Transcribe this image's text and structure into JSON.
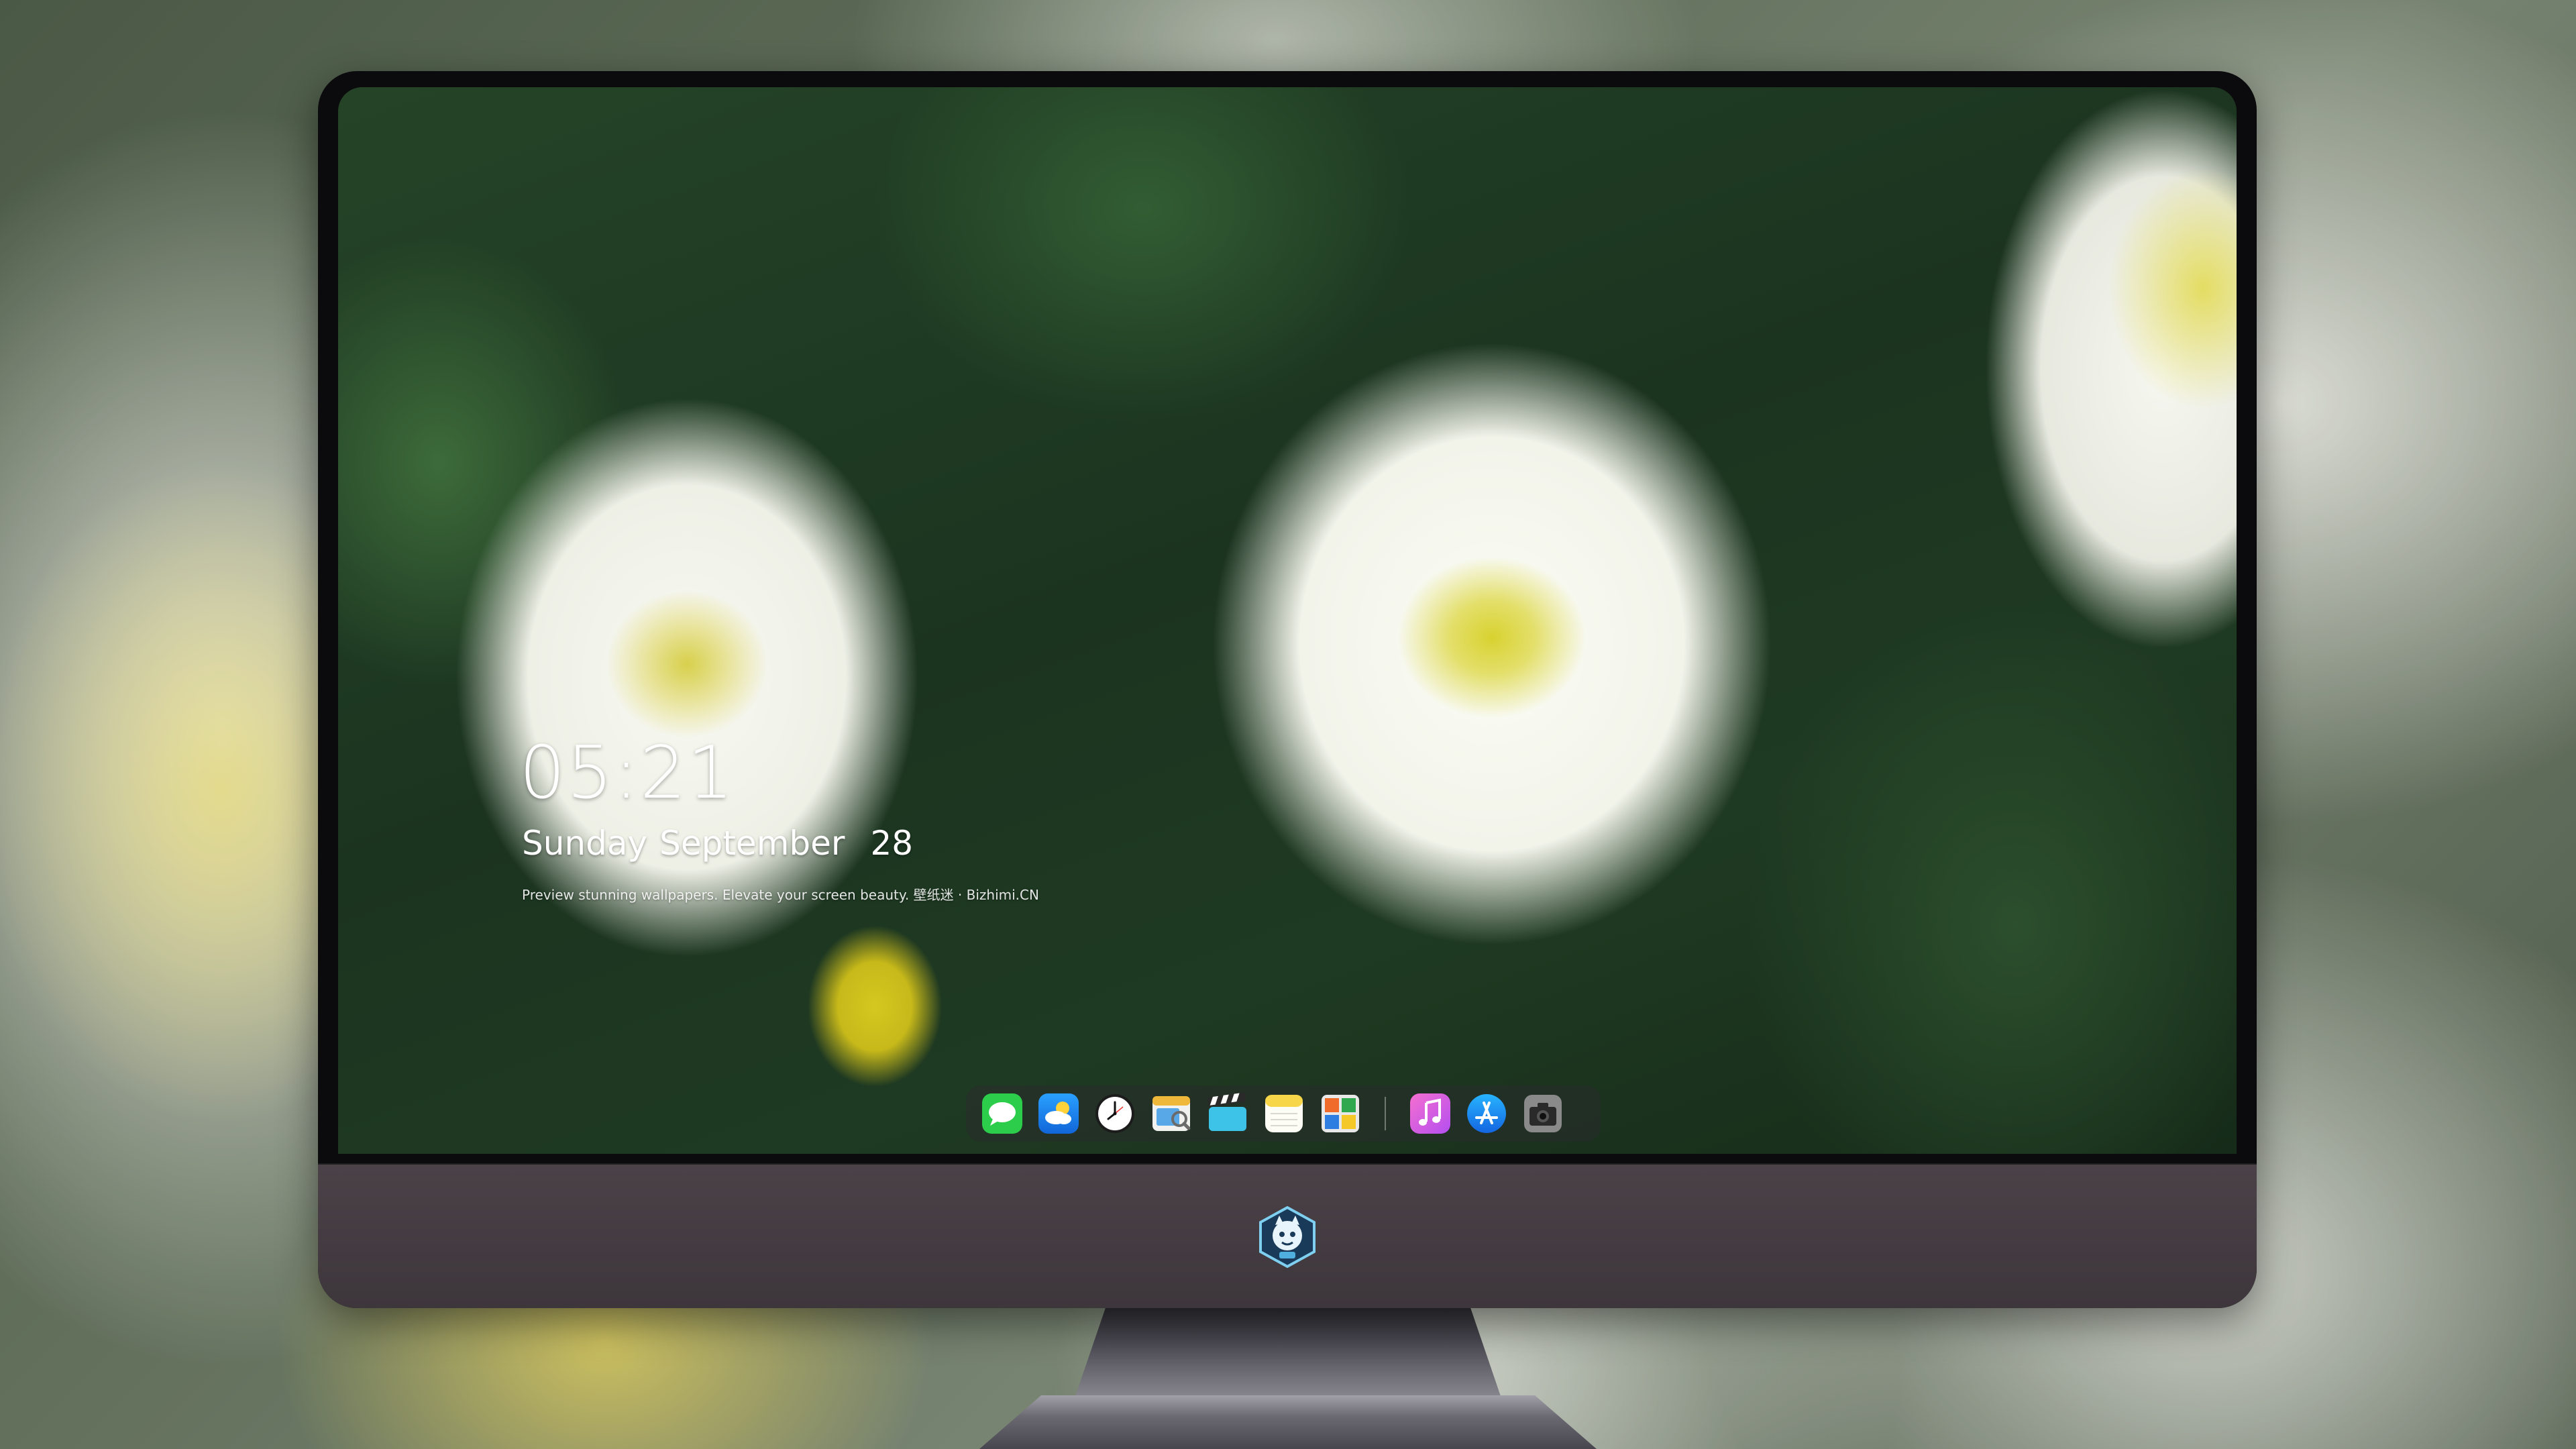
{
  "lockscreen": {
    "time": "05:21",
    "weekday": "Sunday",
    "month": "September",
    "day": "28",
    "tagline": "Preview stunning wallpapers. Elevate your screen beauty. 壁纸迷 · Bizhimi.CN"
  },
  "dock": {
    "apps": [
      {
        "name": "messages",
        "icon": "messages-icon",
        "color": "#2ccd4a"
      },
      {
        "name": "weather",
        "icon": "weather-icon",
        "color": "#1e88f5"
      },
      {
        "name": "clock",
        "icon": "clock-icon",
        "color": "#ffffff"
      },
      {
        "name": "preview",
        "icon": "preview-icon",
        "color": "#f0b83a"
      },
      {
        "name": "videos",
        "icon": "clapperboard-icon",
        "color": "#3ec3e8"
      },
      {
        "name": "notes",
        "icon": "notes-icon",
        "color": "#f7d64a"
      },
      {
        "name": "photo-booth",
        "icon": "photo-grid-icon",
        "color": "#f06a2a"
      },
      {
        "name": "music",
        "icon": "music-note-icon",
        "color": "#f54fa0"
      },
      {
        "name": "app-store",
        "icon": "app-store-icon",
        "color": "#1a8df0"
      },
      {
        "name": "camera",
        "icon": "camera-icon",
        "color": "#7a7a7a"
      }
    ]
  },
  "colors": {
    "monitor_chin": "#4b4248",
    "bezel": "#0b0b0d",
    "clock_text": "#ffffff"
  }
}
